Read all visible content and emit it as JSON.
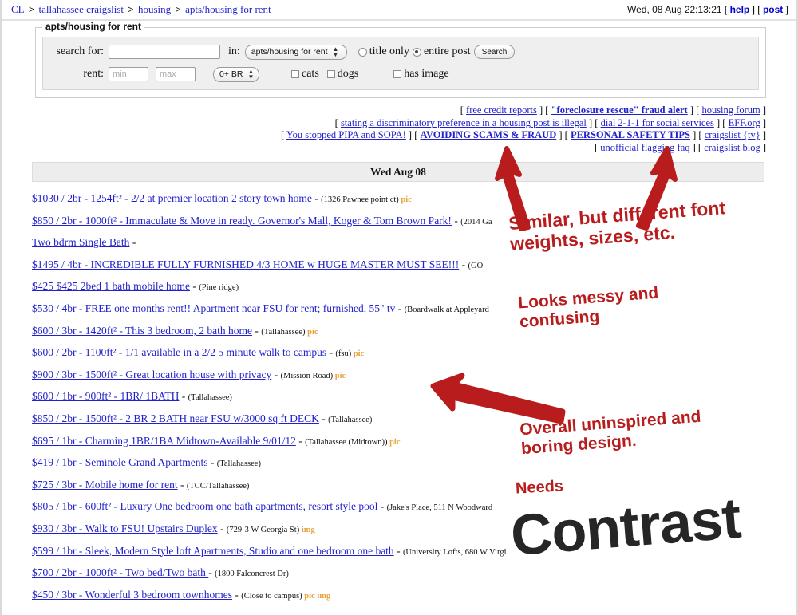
{
  "header": {
    "breadcrumb": [
      {
        "label": "CL",
        "link": true
      },
      {
        "label": "tallahassee craigslist",
        "link": true
      },
      {
        "label": "housing",
        "link": true
      },
      {
        "label": "apts/housing for rent",
        "link": true
      }
    ],
    "separator": ">",
    "datetime": "Wed, 08 Aug 22:13:21",
    "help_label": "help",
    "post_label": "post",
    "bracket_open": "[",
    "bracket_close": "]"
  },
  "search": {
    "legend": "apts/housing for rent",
    "search_for_label": "search for:",
    "search_for_value": "",
    "in_label": "in:",
    "category_selected": "apts/housing for rent",
    "title_only_label": "title only",
    "entire_post_label": "entire post",
    "entire_post_selected": true,
    "search_button": "Search",
    "rent_label": "rent:",
    "rent_min_placeholder": "min",
    "rent_max_placeholder": "max",
    "rent_min_value": "",
    "rent_max_value": "",
    "bedrooms_selected": "0+ BR",
    "cats_label": "cats",
    "dogs_label": "dogs",
    "has_image_label": "has image"
  },
  "links": {
    "rows": [
      [
        {
          "text": "free credit reports",
          "bold": false
        },
        {
          "text": "\"foreclosure rescue\" fraud alert",
          "bold": true
        },
        {
          "text": "housing forum",
          "bold": false
        }
      ],
      [
        {
          "text": "stating a discriminatory preference in a housing post is illegal",
          "bold": false
        },
        {
          "text": "dial 2-1-1 for social services",
          "bold": false
        },
        {
          "text": "EFF.org",
          "bold": false
        }
      ],
      [
        {
          "text": "You stopped PIPA and SOPA!",
          "bold": false
        },
        {
          "text": "AVOIDING SCAMS & FRAUD",
          "bold": true
        },
        {
          "text": "PERSONAL SAFETY TIPS",
          "bold": true
        },
        {
          "text": "craigslist {tv}",
          "bold": false
        }
      ],
      [
        {
          "text": "unofficial flagging faq",
          "bold": false
        },
        {
          "text": "craigslist blog",
          "bold": false
        }
      ]
    ]
  },
  "date_header": "Wed Aug 08",
  "listings": [
    {
      "title": "$1030 / 2br - 1254ft² - 2/2 at premier location 2 story town home",
      "hood": "(1326 Pawnee point ct)",
      "tags": "pic"
    },
    {
      "title": "$850 / 2br - 1000ft² - Immaculate & Move in ready. Governor's Mall, Koger & Tom Brown Park!",
      "hood": "(2014 Ga",
      "tags": ""
    },
    {
      "title": "Two bdrm Single Bath",
      "hood": "",
      "tags": ""
    },
    {
      "title": "$1495 / 4br - INCREDIBLE FULLY FURNISHED 4/3 HOME w HUGE MASTER MUST SEE!!!",
      "hood": "(GO",
      "tags": ""
    },
    {
      "title": "$425 $425 2bed 1 bath mobile home",
      "hood": "(Pine ridge)",
      "tags": ""
    },
    {
      "title": "$530 / 4br - FREE one months rent!! Apartment near FSU for rent; furnished, 55\" tv",
      "hood": "(Boardwalk at Appleyard",
      "tags": ""
    },
    {
      "title": "$600 / 3br - 1420ft² - This 3 bedroom, 2 bath home",
      "hood": "(Tallahassee)",
      "tags": "pic"
    },
    {
      "title": "$600 / 2br - 1100ft² - 1/1 available in a 2/2 5 minute walk to campus",
      "hood": "(fsu)",
      "tags": "pic"
    },
    {
      "title": "$900 / 3br - 1500ft² - Great location house with privacy",
      "hood": "(Mission Road)",
      "tags": "pic"
    },
    {
      "title": "$600 / 1br - 900ft² - 1BR/ 1BATH",
      "hood": "(Tallahassee)",
      "tags": ""
    },
    {
      "title": "$850 / 2br - 1500ft² - 2 BR 2 BATH near FSU w/3000 sq ft DECK",
      "hood": "(Tallahassee)",
      "tags": ""
    },
    {
      "title": "$695 / 1br - Charming 1BR/1BA Midtown-Available 9/01/12",
      "hood": "(Tallahassee (Midtown))",
      "tags": "pic"
    },
    {
      "title": "$419 / 1br - Seminole Grand Apartments",
      "hood": "(Tallahassee)",
      "tags": ""
    },
    {
      "title": "$725 / 3br - Mobile home for rent",
      "hood": "(TCC/Tallahassee)",
      "tags": ""
    },
    {
      "title": "$805 / 1br - 600ft² - Luxury One bedroom one bath apartments, resort style pool",
      "hood": "(Jake's Place, 511 N Woodward",
      "tags": ""
    },
    {
      "title": "$930 / 3br - Walk to FSU! Upstairs Duplex",
      "hood": "(729-3 W Georgia St)",
      "tags": "img"
    },
    {
      "title": "$599 / 1br - Sleek, Modern Style loft Apartments, Studio and one bedroom one bath",
      "hood": "(University Lofts, 680 W Virgi",
      "tags": ""
    },
    {
      "title": "$700 / 2br - 1000ft² - Two bed/Two bath ",
      "hood": "(1800 Falconcrest Dr)",
      "tags": ""
    },
    {
      "title": "$450 / 3br - Wonderful 3 bedroom townhomes",
      "hood": "(Close to campus)",
      "tags": "pic img"
    }
  ],
  "annotations": {
    "font_note_line1": "Similar, but different font",
    "font_note_line2": "weights, sizes, etc.",
    "messy_line1": "Looks messy and",
    "messy_line2": "confusing",
    "boring_line1": "Overall uninspired and",
    "boring_line2": "boring design.",
    "needs_label": "Needs",
    "contrast_label": "Contrast",
    "color_red": "#b91c1c",
    "color_dark": "#262626"
  },
  "colors": {
    "link": "#2222cc",
    "tag": "#e8a33d",
    "panel_bg": "#efefef",
    "date_bar_bg": "#ededed"
  }
}
